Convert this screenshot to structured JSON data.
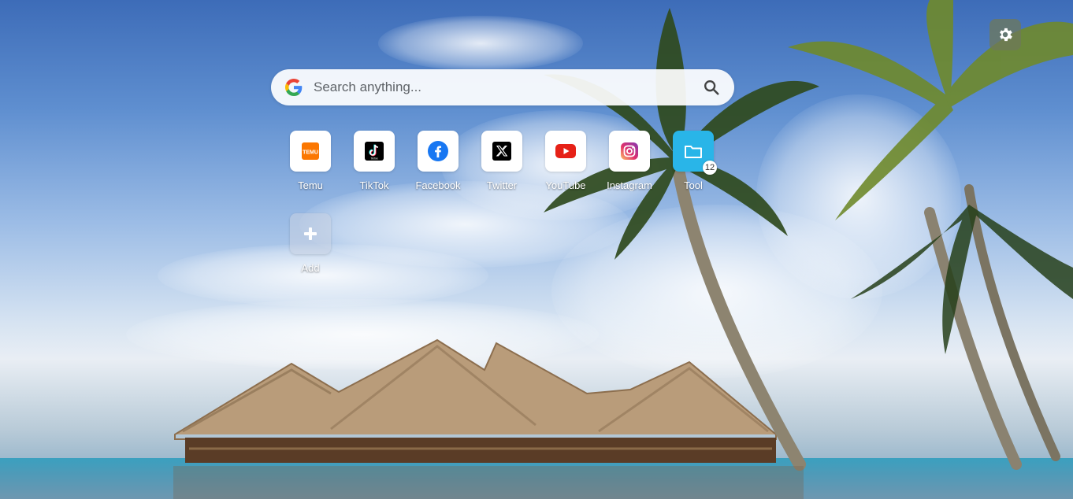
{
  "search": {
    "placeholder": "Search anything..."
  },
  "shortcuts": [
    {
      "label": "Temu",
      "icon": "temu-icon"
    },
    {
      "label": "TikTok",
      "icon": "tiktok-icon"
    },
    {
      "label": "Facebook",
      "icon": "facebook-icon"
    },
    {
      "label": "Twitter",
      "icon": "x-icon"
    },
    {
      "label": "YouTube",
      "icon": "youtube-icon"
    },
    {
      "label": "Instagram",
      "icon": "instagram-icon"
    },
    {
      "label": "Tool",
      "icon": "folder-icon",
      "badge": "12"
    }
  ],
  "temu_logo_text": "TEMU",
  "tiktok_logo_text": "TikTok",
  "add": {
    "label": "Add"
  },
  "colors": {
    "folder": "#29b5e8",
    "youtube": "#e62117",
    "facebook": "#1877f2",
    "temu": "#fb7701"
  }
}
